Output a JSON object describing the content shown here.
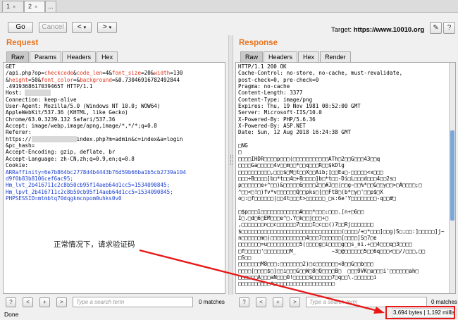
{
  "tabs": [
    {
      "label": "1",
      "active": false
    },
    {
      "label": "2",
      "active": true
    },
    {
      "label": "...",
      "active": false
    }
  ],
  "toolbar": {
    "go_label": "Go",
    "cancel_label": "Cancel",
    "back_label": "<",
    "forward_label": ">",
    "target_label": "Target:",
    "target_value": "https://www.10010.org"
  },
  "request": {
    "title": "Request",
    "tabs": [
      "Raw",
      "Params",
      "Headers",
      "Hex"
    ],
    "active_tab": "Raw",
    "lines": [
      [
        {
          "t": "GET"
        }
      ],
      [
        {
          "t": "/api.php?op="
        },
        {
          "t": "checkcode",
          "c": "param"
        },
        {
          "t": "&"
        },
        {
          "t": "code_len",
          "c": "param"
        },
        {
          "t": "=4&"
        },
        {
          "t": "font_size",
          "c": "param"
        },
        {
          "t": "=20&"
        },
        {
          "t": "width",
          "c": "param"
        },
        {
          "t": "=130"
        }
      ],
      [
        {
          "t": "&"
        },
        {
          "t": "height",
          "c": "param"
        },
        {
          "t": "=50&"
        },
        {
          "t": "font_color",
          "c": "param"
        },
        {
          "t": "=&"
        },
        {
          "t": "background",
          "c": "param"
        },
        {
          "t": "=&0.73046916782492844"
        }
      ],
      [
        {
          "t": ".4919368617039465T HTTP/1.1"
        }
      ],
      [
        {
          "t": "Host: "
        },
        {
          "t": "████████",
          "c": "blur"
        }
      ],
      [
        {
          "t": "Connection: keep-alive"
        }
      ],
      [
        {
          "t": "User-Agent: Mozilla/5.0 (Windows NT 10.0; WOW64)"
        }
      ],
      [
        {
          "t": "AppleWebKit/537.36 (KHTML, like Gecko)"
        }
      ],
      [
        {
          "t": "Chrome/63.0.3239.132 Safari/537.36"
        }
      ],
      [
        {
          "t": "Accept: image/webp,image/apng,image/*,*/*;q=0.8"
        }
      ],
      [
        {
          "t": "Referer:"
        }
      ],
      [
        {
          "t": "https://"
        },
        {
          "t": "██████████████",
          "c": "blur"
        },
        {
          "t": "index.php?m=admin&c=index&a=login"
        }
      ],
      [
        {
          "t": "&pc_hash="
        }
      ],
      [
        {
          "t": "Accept-Encoding: gzip, deflate, br"
        }
      ],
      [
        {
          "t": "Accept-Language: zh-CN,zh;q=0.9,en;q=0.8"
        }
      ],
      [
        {
          "t": "Cookie:"
        }
      ],
      [
        {
          "t": "ARRaffinity=6e7b864bc2778d4b4443b76d59b66ba1b5cb2739a104",
          "c": "blue"
        }
      ],
      [
        {
          "t": "d9f0b83b8106cef6ac95;",
          "c": "blue"
        }
      ],
      [
        {
          "t": "Hm_lvt_2b416711c2c8b50cb95f14aeb64d1cc5=1534090845;",
          "c": "blue"
        }
      ],
      [
        {
          "t": "Hm_lpvt_2b416711c2c8b50cb95f14aeb64d1cc5=1534090845;",
          "c": "blue"
        }
      ],
      [
        {
          "t": "PHPSESSID=mtmbtq70dqgkmcnpom0uhks0v0",
          "c": "blue"
        }
      ]
    ],
    "search_placeholder": "Type a search term",
    "matches": "0 matches"
  },
  "response": {
    "title": "Response",
    "tabs": [
      "Raw",
      "Headers",
      "Hex",
      "Render"
    ],
    "active_tab": "Raw",
    "lines": [
      [
        {
          "t": "HTTP/1.1 200 OK"
        }
      ],
      [
        {
          "t": "Cache-Control: no-store, no-cache, must-revalidate,"
        }
      ],
      [
        {
          "t": "post-check=0, pre-check=0"
        }
      ],
      [
        {
          "t": "Pragma: no-cache"
        }
      ],
      [
        {
          "t": "Content-Length: 3377"
        }
      ],
      [
        {
          "t": "Content-Type: image/png"
        }
      ],
      [
        {
          "t": "Expires: Thu, 19 Nov 1981 08:52:00 GMT"
        }
      ],
      [
        {
          "t": "Server: Microsoft-IIS/10.0"
        }
      ],
      [
        {
          "t": "X-Powered-By: PHP/5.6.36"
        }
      ],
      [
        {
          "t": "X-Powered-By: ASP.NET"
        }
      ],
      [
        {
          "t": "Date: Sun, 12 Aug 2018 16:24:38 GMT"
        }
      ],
      [
        {
          "t": ""
        }
      ],
      [
        {
          "t": "□NG"
        }
      ],
      [
        {
          "t": "□"
        }
      ],
      [
        {
          "t": "□□□□IHDR□□□□p□□□(□□□□□□□□□□□ATh□2□□G□□□43□□q"
        }
      ],
      [
        {
          "t": "□□□□Ga□□□□□4v□□m□□*□□q□□□R□□$kDlg"
        }
      ],
      [
        {
          "t": "□□□□□□□□□□,□□□$□M□t□□X□□Aib;[□□Eu□-□□□□□<x□□□"
        }
      ],
      [
        {
          "t": "□□□+B□□□□]b□*t□□4□+8□□□□]b□*t□□-Di□L□□□d□□□4□□2s□"
        }
      ],
      [
        {
          "t": "p□□□□□□e+^□□)&□□□□□6□□□□2□□#J□□|□□g~□□%*□□G□□y□□>□A□□□□;□"
        }
      ],
      [
        {
          "t": "^□□<□!□)fv*v□□□□□□Q□□pks□[□□Ft8□(b*□y□'□□p$□X"
        }
      ],
      [
        {
          "t": "o□:□f□□□□□□|□□4t□□□t>□□□□□□_□s:6e'Y□□□□□□□□-q□□#□"
        }
      ],
      [
        {
          "t": ""
        }
      ],
      [
        {
          "t": "□$p□□□1□□□□□□□□□□□□#□□□*□□□:□□□.[n+□6□□"
        }
      ],
      [
        {
          "t": "I□.□d□6□EM□□□e^□.Y□k□□j□□□+□"
        }
      ],
      [
        {
          "t": ",□□□□□□□n□□c□□□□□□7□□□□I□c□□()7□□Rj□□□□□□□"
        }
      ],
      [
        {
          "t": "$□□□□□□□□□□□□□□□□□□□□□□□□□□□□□□□(□□□□/+□*□□□]□□g)S□;□□:]□□□□□]j~"
        }
      ],
      [
        {
          "t": "n□□□□□□m□)□□□□□□□□□□□4□□□7□□□□□□[□□□□]S□7□e"
        }
      ],
      [
        {
          "t": "□□□□□□□=u□□□□□□□□□□5(□□□□g□i□□□□g□□s_ni.+□□4□□□q□3□□□□"
        }
      ],
      [
        {
          "t": "□f□□□□□'□□□□□□□□M_           ~3□@□□□□□□5□□6q□□□<□□//□□□,□□"
        }
      ],
      [
        {
          "t": "□S□□"
        }
      ],
      [
        {
          "t": "□□□□□□□M8□□□:□□□□□□□2)□c□□□□□□□<8□□G□□b□□□"
        }
      ],
      [
        {
          "t": "□□□□[□□□□$□]□□i□□□G□□W□8□Q□□□□B□  □□□9VK□a□□□i'□□□□□□ah□"
        }
      ],
      [
        {
          "t": "□□□□□□A□□□aN□□□0!□□□□□$□□□□□□7□q□□\\.□□□□□□i"
        }
      ],
      [
        {
          "t": "□□□□□□□□□□*□□□□□□□□□□□□□□□□□□□"
        }
      ]
    ],
    "search_placeholder": "Type a search term",
    "matches": "0 matches"
  },
  "status": {
    "left": "Done",
    "stats": "3,694 bytes | 1,192 millis"
  },
  "annotation": {
    "text": "正常情况下，请求验证码",
    "color": "#e81818"
  }
}
